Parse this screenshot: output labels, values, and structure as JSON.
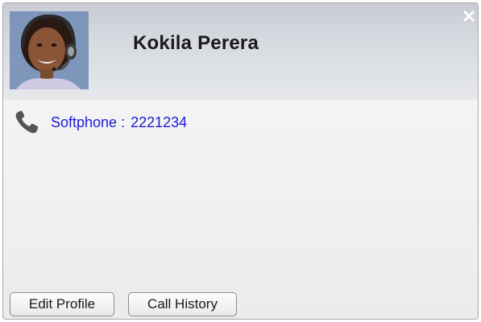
{
  "contact": {
    "name": "Kokila Perera"
  },
  "phone": {
    "label": "Softphone",
    "separator": ":",
    "number": "2221234"
  },
  "actions": {
    "edit_profile_label": "Edit Profile",
    "call_history_label": "Call History"
  },
  "icons": {
    "close": "close-icon",
    "phone": "phone-handset-icon",
    "avatar": "avatar"
  },
  "colors": {
    "link": "#1a1ad6",
    "header_top": "#c9ccd3",
    "header_bottom": "#e6e8ec",
    "avatar_bg": "#7d96ba"
  }
}
